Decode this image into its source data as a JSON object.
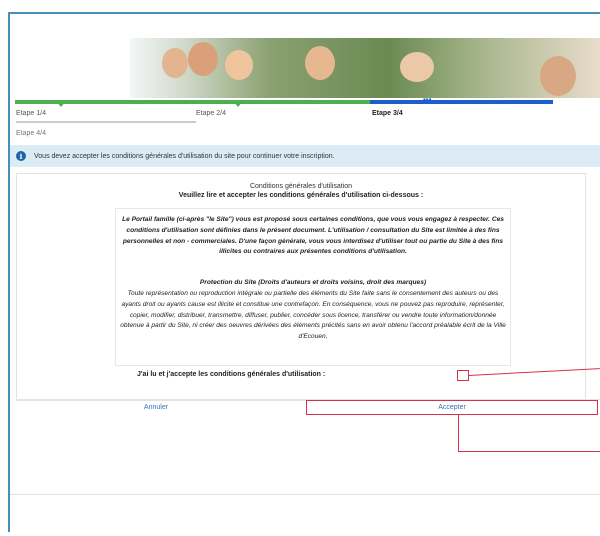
{
  "steps": {
    "step1": "Etape 1/4",
    "step2": "Etape 2/4",
    "step3": "Etape 3/4",
    "step4": "Etape 4/4"
  },
  "alert": {
    "icon": "info-icon",
    "text": "Vous devez accepter les conditions générales d'utilisation du site pour continuer votre inscription."
  },
  "cgu": {
    "title": "Conditions générales d'utilisation",
    "instruction": "Veuillez lire et accepter les conditions générales d'utilisation ci-dessous :",
    "intro": "Le Portail famille (ci-après \"le Site\") vous est proposé sous certaines conditions, que vous vous engagez à respecter. Ces conditions d'utilisation sont définies dans le présent document. L'utilisation / consultation du Site est limitée à des fins personnelles et non - commerciales. D'une façon générale, vous vous interdisez d'utiliser tout ou partie du Site à des fins illicites ou contraires aux présentes conditions d'utilisation.",
    "section_title": "Protection du Site (Droits d'auteurs et droits voisins, droit des marques)",
    "section_text": "Toute représentation ou reproduction intégrale ou partielle des éléments du Site faite sans le consentement des auteurs ou des ayants droit ou ayants cause est illicite et constitue une contrefaçon. En conséquence, vous ne pouvez pas reproduire, représenter, copier, modifier, distribuer, transmettre, diffuser, publier, concéder sous licence, transférer ou vendre toute information/donnée obtenue à partir du Site, ni créer des oeuvres dérivées des éléments précités sans en avoir obtenu l'accord préalable écrit de la Ville d'Ecouen,",
    "accept_label": "J'ai lu et j'accepte les conditions générales d'utilisation :"
  },
  "buttons": {
    "cancel": "Annuler",
    "accept": "Accepter"
  },
  "colors": {
    "progress_done": "#4caf50",
    "progress_active": "#1c5fc9",
    "alert_bg": "#dcecf7",
    "annotation": "#d3304a",
    "link": "#3a6fb8"
  }
}
